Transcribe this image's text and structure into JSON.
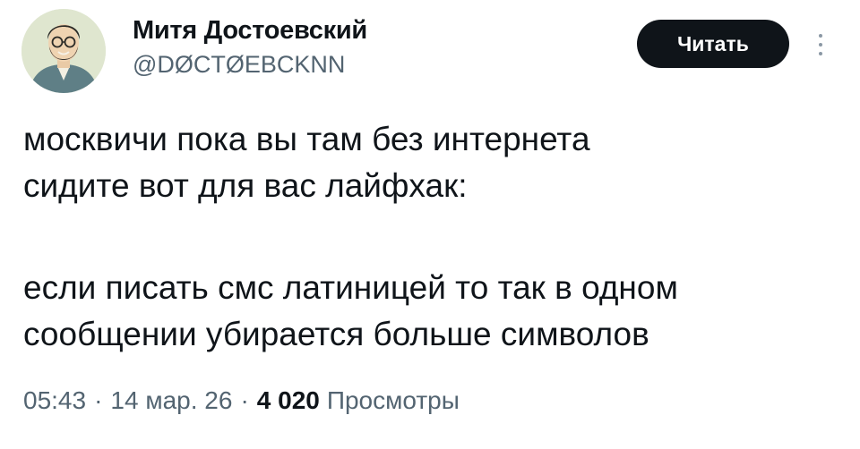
{
  "author": {
    "display_name": "Митя Достоевский",
    "handle": "@DØCTØEBCKNN"
  },
  "follow_button_label": "Читать",
  "more_icon": "more-vertical-icon",
  "tweet": {
    "lines": [
      "москвичи пока вы там без интернета",
      "сидите вот для вас лайфхак:",
      "если писать смс латиницей то так в одном",
      "сообщении убирается больше символов"
    ]
  },
  "meta": {
    "time": "05:43",
    "separator": "·",
    "date": "14 мар. 26",
    "views_count": "4 020",
    "views_label": "Просмотры"
  },
  "colors": {
    "text": "#0f1419",
    "secondary": "#536471",
    "button_bg": "#0f1419",
    "button_text": "#ffffff"
  }
}
